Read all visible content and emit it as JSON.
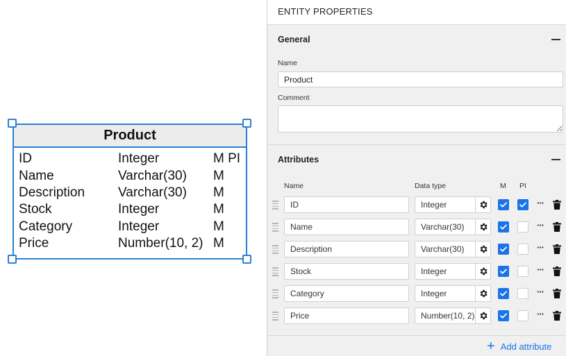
{
  "entity": {
    "title": "Product",
    "rows": [
      {
        "name": "ID",
        "type": "Integer",
        "flags": "M PI"
      },
      {
        "name": "Name",
        "type": "Varchar(30)",
        "flags": "M"
      },
      {
        "name": "Description",
        "type": "Varchar(30)",
        "flags": "M"
      },
      {
        "name": "Stock",
        "type": "Integer",
        "flags": "M"
      },
      {
        "name": "Category",
        "type": "Integer",
        "flags": "M"
      },
      {
        "name": "Price",
        "type": "Number(10, 2)",
        "flags": "M"
      }
    ]
  },
  "panel": {
    "title": "ENTITY PROPERTIES",
    "general": {
      "heading": "General",
      "name_label": "Name",
      "name_value": "Product",
      "comment_label": "Comment",
      "comment_value": ""
    },
    "attributes": {
      "heading": "Attributes",
      "col_name": "Name",
      "col_type": "Data type",
      "col_m": "M",
      "col_pi": "PI",
      "rows": [
        {
          "name": "ID",
          "type": "Integer",
          "m": true,
          "pi": true
        },
        {
          "name": "Name",
          "type": "Varchar(30)",
          "m": true,
          "pi": false
        },
        {
          "name": "Description",
          "type": "Varchar(30)",
          "m": true,
          "pi": false
        },
        {
          "name": "Stock",
          "type": "Integer",
          "m": true,
          "pi": false
        },
        {
          "name": "Category",
          "type": "Integer",
          "m": true,
          "pi": false
        },
        {
          "name": "Price",
          "type": "Number(10, 2)",
          "m": true,
          "pi": false
        }
      ],
      "more_label": "···",
      "add_label": "Add attribute"
    }
  },
  "icons": {
    "section_toggle": "minus-icon",
    "drag": "drag-handle-icon",
    "settings": "gear-icon",
    "check": "check-icon",
    "more": "more-icon",
    "delete": "trash-icon",
    "add": "plus-icon"
  },
  "colors": {
    "selection": "#2b7fd6",
    "accent": "#1a73e8",
    "panel_bg": "#f0f0f0"
  }
}
